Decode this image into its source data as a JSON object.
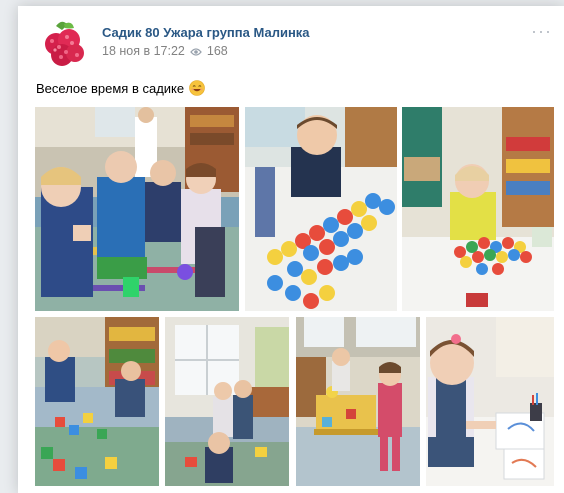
{
  "post": {
    "author": "Садик 80 Ужара группа Малинка",
    "date": "18 ноя в 17:22",
    "views": "168",
    "text": "Веселое время в садике",
    "more": "···"
  },
  "icons": {
    "avatar": "raspberry-avatar",
    "views": "eye-icon",
    "emoji": "smiling-face-emoji"
  },
  "photos": [
    {
      "name": "kids-on-carpet-thumbs-up"
    },
    {
      "name": "boy-building-flower-mosaic"
    },
    {
      "name": "girl-with-flower-mosaic"
    },
    {
      "name": "boys-playing-with-blocks"
    },
    {
      "name": "kids-in-classroom"
    },
    {
      "name": "kids-at-play-table"
    },
    {
      "name": "girl-coloring"
    }
  ],
  "colors": {
    "link": "#2a5885",
    "meta": "#828282",
    "background": "#e9ecef"
  }
}
